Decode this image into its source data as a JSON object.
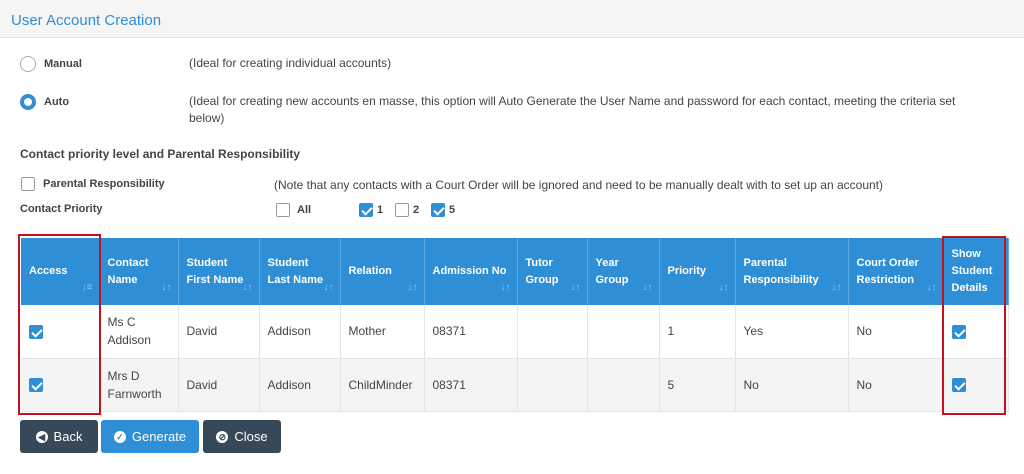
{
  "dialog": {
    "title": "User Account Creation"
  },
  "mode": {
    "manual": {
      "label": "Manual",
      "description": "(Ideal for creating individual accounts)",
      "selected": false
    },
    "auto": {
      "label": "Auto",
      "description_line1": "(Ideal for creating new accounts en masse, this option will Auto Generate the User Name and password for each contact, meeting the criteria set",
      "description_line2": "below)",
      "selected": true
    }
  },
  "criteria": {
    "section_title": "Contact priority level and Parental Responsibility",
    "parental_responsibility": {
      "label": "Parental Responsibility",
      "checked": false,
      "note": "(Note that any contacts with a Court Order will be ignored and need to be manually dealt with to set up an account)"
    },
    "contact_priority": {
      "label": "Contact Priority",
      "options": [
        {
          "label": "All",
          "checked": false
        },
        {
          "label": "1",
          "checked": true
        },
        {
          "label": "2",
          "checked": false
        },
        {
          "label": "5",
          "checked": true
        }
      ]
    }
  },
  "table": {
    "headers": [
      {
        "label": "Access",
        "sort": "↓≡"
      },
      {
        "label": "Contact Name",
        "sort": "↓↑"
      },
      {
        "label": "Student First Name",
        "sort": "↓↑"
      },
      {
        "label": "Student Last Name",
        "sort": "↓↑"
      },
      {
        "label": "Relation",
        "sort": "↓↑"
      },
      {
        "label": "Admission No",
        "sort": "↓↑"
      },
      {
        "label": "Tutor Group",
        "sort": "↓↑"
      },
      {
        "label": "Year Group",
        "sort": "↓↑"
      },
      {
        "label": "Priority",
        "sort": "↓↑"
      },
      {
        "label": "Parental Responsibility",
        "sort": "↓↑"
      },
      {
        "label": "Court Order Restriction",
        "sort": "↓↑"
      },
      {
        "label": "Show Student Details",
        "sort": ""
      }
    ],
    "rows": [
      {
        "access": true,
        "contact_name": "Ms C Addison",
        "first_name": "David",
        "last_name": "Addison",
        "relation": "Mother",
        "admission_no": "08371",
        "tutor_group": "",
        "year_group": "",
        "priority": "1",
        "parental_responsibility": "Yes",
        "court_order": "No",
        "show_details": true
      },
      {
        "access": true,
        "contact_name": "Mrs D Farnworth",
        "first_name": "David",
        "last_name": "Addison",
        "relation": "ChildMinder",
        "admission_no": "08371",
        "tutor_group": "",
        "year_group": "",
        "priority": "5",
        "parental_responsibility": "No",
        "court_order": "No",
        "show_details": true
      }
    ]
  },
  "buttons": {
    "back": "Back",
    "generate": "Generate",
    "close": "Close"
  },
  "colors": {
    "accent": "#2e8fd6",
    "dark_button": "#374859",
    "highlight": "#c1121f"
  },
  "icons": {
    "back": "arrow-left-circle-icon",
    "generate": "check-circle-icon",
    "close": "ban-circle-icon"
  }
}
